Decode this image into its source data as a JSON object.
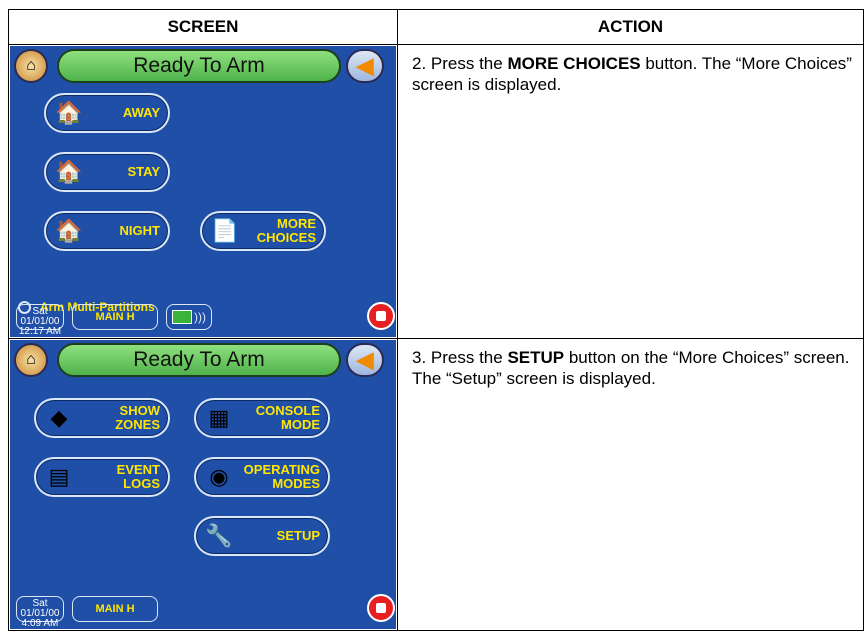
{
  "headers": {
    "screen": "SCREEN",
    "action": "ACTION"
  },
  "rows": [
    {
      "screen": {
        "title": "Ready To Arm",
        "buttons": {
          "away": "AWAY",
          "stay": "STAY",
          "night": "NIGHT",
          "more_l1": "MORE",
          "more_l2": "CHOICES"
        },
        "radio_label": "Arm Multi-Partitions",
        "date_l1": "Sat 01/01/00",
        "date_l2": "12:17 AM",
        "main_label": "MAIN H"
      },
      "action": {
        "prefix": "2.  Press the ",
        "bold": "MORE CHOICES",
        "suffix": " button. The “More Choices” screen is displayed."
      }
    },
    {
      "screen": {
        "title": "Ready To Arm",
        "buttons": {
          "show_l1": "SHOW",
          "show_l2": "ZONES",
          "console_l1": "CONSOLE",
          "console_l2": "MODE",
          "event_l1": "EVENT",
          "event_l2": "LOGS",
          "operating_l1": "OPERATING",
          "operating_l2": "MODES",
          "setup": "SETUP"
        },
        "date_l1": "Sat 01/01/00",
        "date_l2": "4:09 AM",
        "main_label": "MAIN H"
      },
      "action": {
        "prefix": "3.  Press the ",
        "bold": "SETUP",
        "suffix": " button on the “More Choices” screen.  The “Setup” screen is displayed."
      }
    }
  ],
  "colors": {
    "screen_bg": "#1f4fa6",
    "label": "#ffe600",
    "title_bar": "#5cc052"
  }
}
